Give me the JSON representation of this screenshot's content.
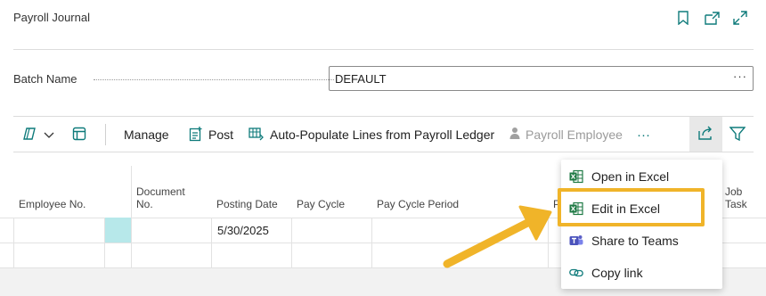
{
  "header": {
    "title": "Payroll Journal"
  },
  "field": {
    "label": "Batch Name",
    "value": "DEFAULT",
    "more": "···"
  },
  "toolbar": {
    "manage_label": "Manage",
    "post_label": "Post",
    "autopopulate_label": "Auto-Populate Lines from Payroll Ledger",
    "payroll_employee_label": "Payroll Employee",
    "more_label": "···"
  },
  "grid": {
    "columns": [
      "Employee No.",
      "Document No.",
      "Posting Date",
      "Pay Cycle",
      "Pay Cycle Period",
      "P",
      "Job Task"
    ],
    "document_no_line1": "Document",
    "document_no_line2": "No.",
    "rows": [
      {
        "posting_date": "5/30/2025"
      },
      {
        "posting_date": ""
      }
    ]
  },
  "share_menu": {
    "items": [
      {
        "label": "Open in Excel",
        "icon": "excel-icon"
      },
      {
        "label": "Edit in Excel",
        "icon": "excel-icon",
        "highlighted": true
      },
      {
        "label": "Share to Teams",
        "icon": "teams-icon"
      },
      {
        "label": "Copy link",
        "icon": "link-icon"
      }
    ]
  },
  "colors": {
    "accent": "#0f7b7b",
    "highlight": "#f0b429",
    "selected_cell": "#b7e8ea"
  }
}
